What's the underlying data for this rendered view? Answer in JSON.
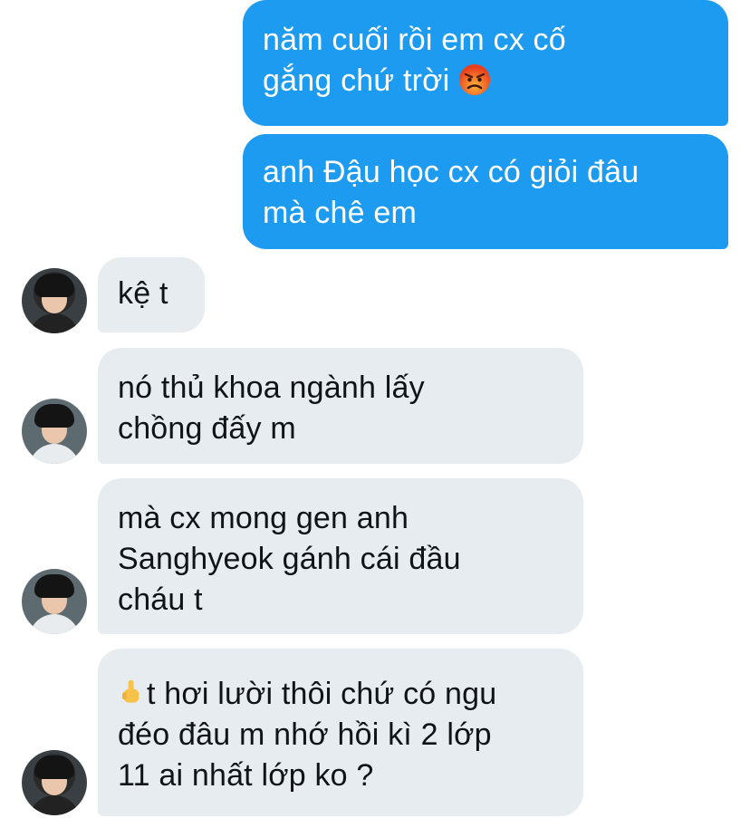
{
  "messages": [
    {
      "id": "m1",
      "side": "sent",
      "text": "năm cuối rồi em cx cố\ngắng chứ trời",
      "emoji": "angry-face-icon"
    },
    {
      "id": "m2",
      "side": "sent",
      "text": "anh Đậu học cx có giỏi đâu\nmà chê em"
    },
    {
      "id": "m3",
      "side": "received",
      "text": "kệ t"
    },
    {
      "id": "m4",
      "side": "received",
      "text": "nó thủ khoa ngành lấy\nchồng đấy m"
    },
    {
      "id": "m5",
      "side": "received",
      "text": "mà cx mong gen anh\nSanghyeok gánh cái đầu\ncháu t"
    },
    {
      "id": "m6",
      "side": "received",
      "text": "t hơi lười thôi chứ có ngu\nđéo đâu m nhớ hồi kì 2 lớp\n11 ai nhất lớp ko ?",
      "emoji": "middle-finger-icon"
    }
  ],
  "colors": {
    "sent_bubble": "#1d9bf0",
    "received_bubble": "#e7ecf0",
    "sent_text": "#ffffff",
    "received_text": "#0f1419"
  }
}
